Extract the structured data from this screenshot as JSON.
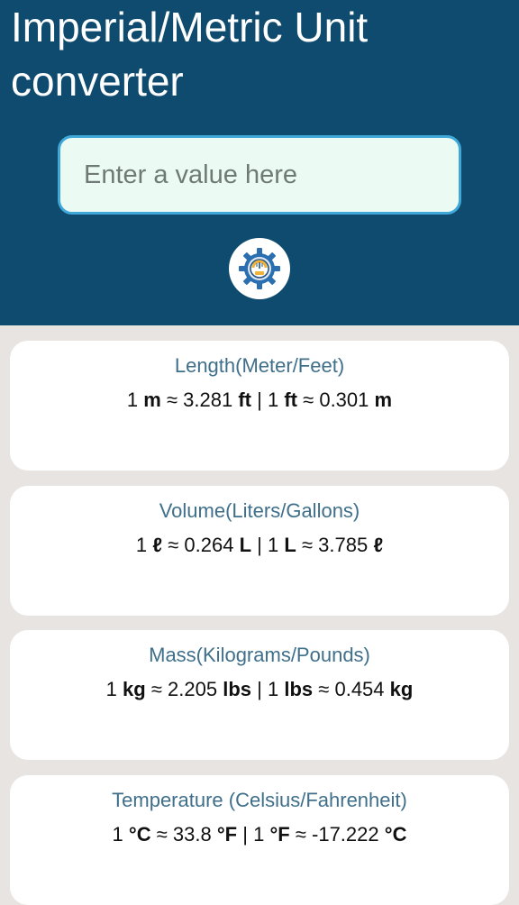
{
  "header": {
    "title": "Imperial/Metric Unit converter",
    "background_color": "#0e4b6e"
  },
  "input": {
    "placeholder": "Enter a value here",
    "value": ""
  },
  "convert_button": {
    "icon": "gear-scale-icon"
  },
  "conversions": [
    {
      "title": "Length(Meter/Feet)",
      "parts": {
        "a_qty": "1",
        "a_unit": "m",
        "a_approx": "≈ 3.281",
        "a_result_unit": "ft",
        "sep": "|",
        "b_qty": "1",
        "b_unit": "ft",
        "b_approx": "≈ 0.301",
        "b_result_unit": "m"
      }
    },
    {
      "title": "Volume(Liters/Gallons)",
      "parts": {
        "a_qty": "1",
        "a_unit": "ℓ",
        "a_approx": "≈ 0.264",
        "a_result_unit": "L",
        "sep": "|",
        "b_qty": "1",
        "b_unit": "L",
        "b_approx": "≈ 3.785",
        "b_result_unit": "ℓ"
      }
    },
    {
      "title": "Mass(Kilograms/Pounds)",
      "parts": {
        "a_qty": "1",
        "a_unit": "kg",
        "a_approx": "≈ 2.205",
        "a_result_unit": "lbs",
        "sep": "|",
        "b_qty": "1",
        "b_unit": "lbs",
        "b_approx": "≈ 0.454",
        "b_result_unit": "kg"
      }
    },
    {
      "title": "Temperature (Celsius/Fahrenheit)",
      "parts": {
        "a_qty": "1",
        "a_unit": "°C",
        "a_approx": "≈ 33.8",
        "a_result_unit": "°F",
        "sep": "|",
        "b_qty": "1",
        "b_unit": "°F",
        "b_approx": "≈ -17.222",
        "b_result_unit": "°C"
      }
    }
  ],
  "colors": {
    "page_background": "#e8e4e2",
    "card_title": "#3f6f8a",
    "input_border": "#3fa8d8",
    "input_background": "#ebfbf4"
  }
}
